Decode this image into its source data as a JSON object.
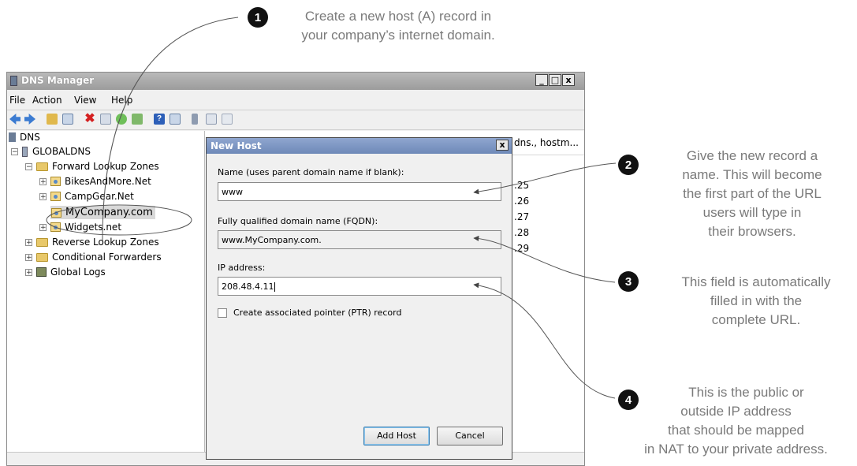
{
  "annotations": [
    {
      "num": "1",
      "lines": [
        "Create a new host (A) record in",
        "your company’s internet domain."
      ]
    },
    {
      "num": "2",
      "lines": [
        "Give the new record a",
        "name. This will become",
        "the first part of the URL",
        "users will type in",
        "their browsers."
      ]
    },
    {
      "num": "3",
      "lines": [
        "This field is automatically",
        "filled in with the",
        "complete URL."
      ]
    },
    {
      "num": "4",
      "lines": [
        "This is the public or",
        "outside IP address",
        "that should be mapped",
        "in NAT to your private address."
      ]
    }
  ],
  "window": {
    "title": "DNS Manager",
    "buttons": [
      "_",
      "□",
      "x"
    ],
    "menu": [
      "File",
      "Action",
      "View",
      "Help"
    ]
  },
  "tree": {
    "root": "DNS",
    "server": "GLOBALDNS",
    "forward": "Forward Lookup Zones",
    "zones": [
      "BikesAndMore.Net",
      "CampGear.Net",
      "MyCompany.com",
      "Widgets.net"
    ],
    "reverse": "Reverse Lookup Zones",
    "conditional": "Conditional Forwarders",
    "logs": "Global Logs"
  },
  "right_pane": {
    "header_fragment": "dns., hostm...",
    "values": [
      ".25",
      ".26",
      ".27",
      ".28",
      ".29"
    ]
  },
  "dialog": {
    "title": "New Host",
    "close": "x",
    "name_label": "Name (uses parent domain name if blank):",
    "name_value": "www",
    "fqdn_label": "Fully qualified domain name (FQDN):",
    "fqdn_value": "www.MyCompany.com.",
    "ip_label": "IP address:",
    "ip_value": "208.48.4.11",
    "ptr_label": "Create associated pointer (PTR) record",
    "ptr_checked": false,
    "add_button": "Add Host",
    "cancel_button": "Cancel"
  }
}
